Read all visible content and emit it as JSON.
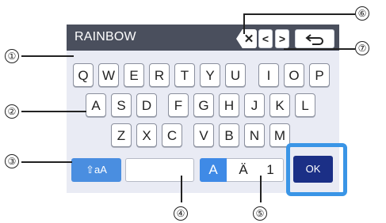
{
  "text_field": {
    "value": "RAINBOW"
  },
  "top_buttons": {
    "delete_glyph": "✕",
    "left_glyph": "<",
    "right_glyph": ">",
    "back_icon": "return-arrow-icon"
  },
  "keyboard": {
    "row1": [
      "Q",
      "W",
      "E",
      "R",
      "T",
      "Y",
      "U",
      "I",
      "O",
      "P"
    ],
    "row2": [
      "A",
      "S",
      "D",
      "F",
      "G",
      "H",
      "J",
      "K",
      "L"
    ],
    "row3": [
      "Z",
      "X",
      "C",
      "V",
      "B",
      "N",
      "M"
    ]
  },
  "bottom": {
    "shift_label": "⇧aA",
    "mode_labels": [
      "A",
      "Ä",
      "1"
    ],
    "ok_label": "OK"
  },
  "callouts": [
    "①",
    "②",
    "③",
    "④",
    "⑤",
    "⑥",
    "⑦"
  ],
  "colors": {
    "accent": "#3a95e6",
    "ok": "#1b2f86",
    "bar": "#4a4f5d"
  }
}
